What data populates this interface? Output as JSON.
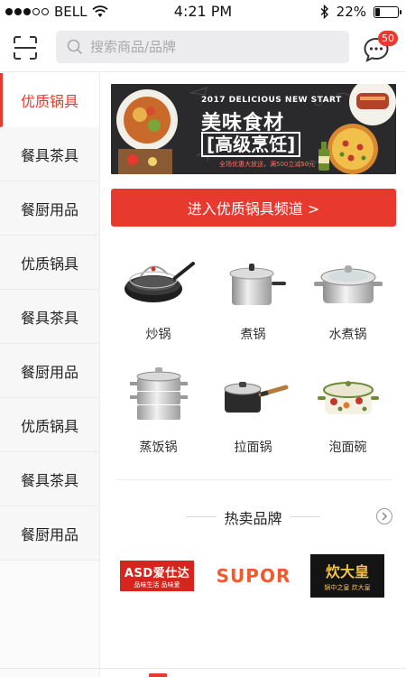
{
  "status_bar": {
    "carrier": "BELL",
    "time": "4:21 PM",
    "battery": "22%",
    "battery_level": 0.22
  },
  "header": {
    "search_placeholder": "搜索商品/品牌",
    "message_badge": "50"
  },
  "sidebar": {
    "items": [
      {
        "label": "优质锅具"
      },
      {
        "label": "餐具茶具"
      },
      {
        "label": "餐厨用品"
      },
      {
        "label": "优质锅具"
      },
      {
        "label": "餐具茶具"
      },
      {
        "label": "餐厨用品"
      },
      {
        "label": "优质锅具"
      },
      {
        "label": "餐具茶具"
      },
      {
        "label": "餐厨用品"
      }
    ],
    "active_index": 0
  },
  "banner": {
    "subtitle": "2017 DELICIOUS NEW START",
    "title": "美味食材",
    "title2": "[高级烹饪]",
    "note": "全场优惠大放送，满500立减50元"
  },
  "cta": {
    "label": "进入优质锅具频道 >"
  },
  "products": [
    {
      "name": "炒锅",
      "icon": "wok-pan-icon"
    },
    {
      "name": "煮锅",
      "icon": "stock-pot-icon"
    },
    {
      "name": "水煮锅",
      "icon": "soup-pot-icon"
    },
    {
      "name": "蒸饭锅",
      "icon": "steamer-pot-icon"
    },
    {
      "name": "拉面锅",
      "icon": "noodle-pot-icon"
    },
    {
      "name": "泡面碗",
      "icon": "enamel-bowl-icon"
    }
  ],
  "brands_section": {
    "title": "热卖品牌",
    "brands": [
      {
        "name": "ASD爱仕达",
        "tagline": "品味生活 品味爱"
      },
      {
        "name": "SUPOR"
      },
      {
        "name": "炊大皇",
        "tagline": "锅中之皇 炊大皇"
      }
    ]
  },
  "colors": {
    "accent": "#e8392f",
    "search_bg": "#ececee",
    "sidebar_bg": "#f7f7f7"
  }
}
